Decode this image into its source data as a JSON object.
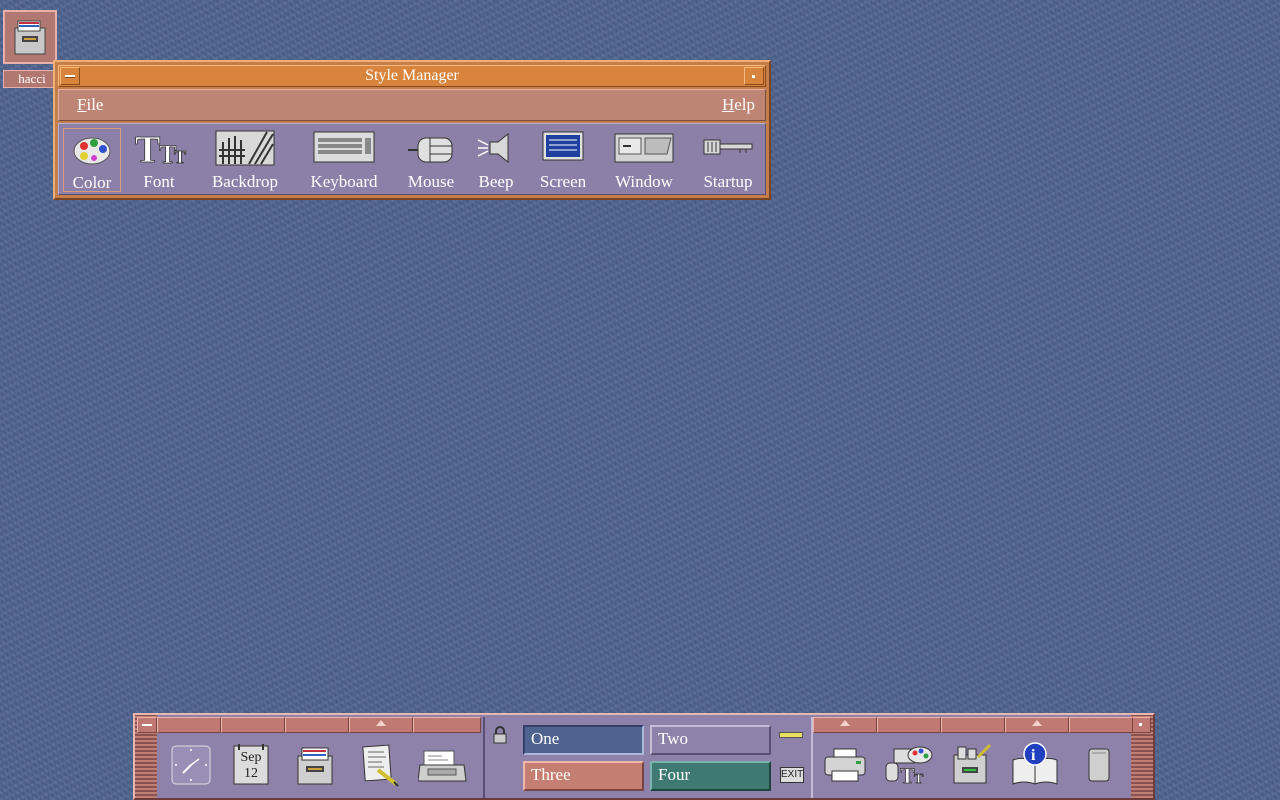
{
  "desktop": {
    "icon_label": "hacci"
  },
  "style_manager": {
    "title": "Style Manager",
    "menu": {
      "file_mnemonic": "F",
      "file_rest": "ile",
      "help_mnemonic": "H",
      "help_rest": "elp"
    },
    "tools": [
      {
        "label": "Color",
        "icon": "palette-icon"
      },
      {
        "label": "Font",
        "icon": "font-icon"
      },
      {
        "label": "Backdrop",
        "icon": "backdrop-icon"
      },
      {
        "label": "Keyboard",
        "icon": "keyboard-icon"
      },
      {
        "label": "Mouse",
        "icon": "mouse-icon"
      },
      {
        "label": "Beep",
        "icon": "speaker-icon"
      },
      {
        "label": "Screen",
        "icon": "screen-icon"
      },
      {
        "label": "Window",
        "icon": "window-icon"
      },
      {
        "label": "Startup",
        "icon": "key-icon"
      }
    ]
  },
  "front_panel": {
    "calendar": {
      "month": "Sep",
      "day": "12"
    },
    "workspaces": [
      "One",
      "Two",
      "Three",
      "Four"
    ],
    "exit_label": "EXIT",
    "colors": {
      "workspace_one": "#4e6390",
      "workspace_two": "#8f82aa",
      "workspace_three": "#c47e72",
      "workspace_four": "#3f7a72",
      "backdrop": "#4e6390",
      "title_active": "#d9843c"
    }
  }
}
